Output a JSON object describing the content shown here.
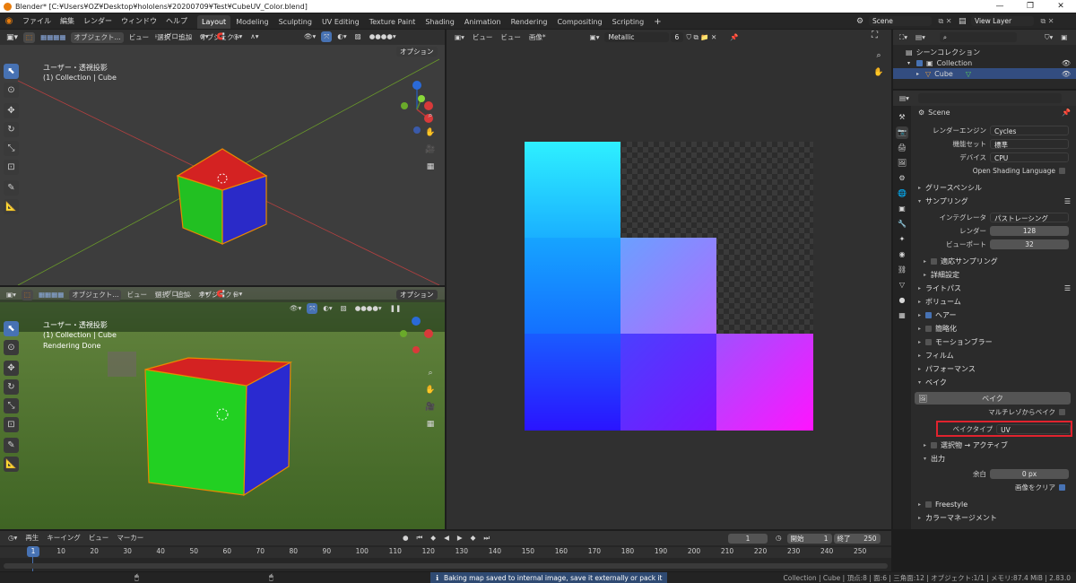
{
  "window": {
    "title": "Blender* [C:¥Users¥OZ¥Desktop¥hololens¥20200709¥Test¥CubeUV_Color.blend]"
  },
  "menu": [
    "ファイル",
    "編集",
    "レンダー",
    "ウィンドウ",
    "ヘルプ"
  ],
  "workspaces": [
    "Layout",
    "Modeling",
    "Sculpting",
    "UV Editing",
    "Texture Paint",
    "Shading",
    "Animation",
    "Rendering",
    "Compositing",
    "Scripting"
  ],
  "top_right": {
    "scene": "Scene",
    "view_layer": "View Layer"
  },
  "viewport_top": {
    "mode": "オブジェクト...",
    "menus": [
      "ビュー",
      "選択",
      "追加",
      "オブジェクト"
    ],
    "transform": "グロー...",
    "options": "オプション",
    "overlay_title": "ユーザー・透視投影",
    "overlay_sub": "(1) Collection | Cube"
  },
  "viewport_bottom": {
    "mode": "オブジェクト...",
    "menus": [
      "ビュー",
      "選択",
      "追加",
      "オブジェクト"
    ],
    "transform": "グロー...",
    "options": "オプション",
    "overlay_title": "ユーザー・透視投影",
    "overlay_sub": "(1) Collection | Cube",
    "overlay_status": "Rendering Done"
  },
  "image_editor": {
    "menus": [
      "ビュー",
      "ビュー",
      "画像*"
    ],
    "image_name": "Metallic",
    "users": "6"
  },
  "outliner": {
    "root": "シーンコレクション",
    "collection": "Collection",
    "object": "Cube"
  },
  "properties": {
    "scene": "Scene",
    "render_engine_label": "レンダーエンジン",
    "render_engine": "Cycles",
    "feature_set_label": "機能セット",
    "feature_set": "標準",
    "device_label": "デバイス",
    "device": "CPU",
    "osl_label": "Open Shading Language",
    "grease_pencil": "グリースペンシル",
    "sampling": "サンプリング",
    "integrator_label": "インテグレータ",
    "integrator": "パストレーシング",
    "render_label": "レンダー",
    "render_samples": "128",
    "viewport_label": "ビューポート",
    "viewport_samples": "32",
    "adaptive": "適応サンプリング",
    "advanced": "詳細設定",
    "light_paths": "ライトパス",
    "volumes": "ボリューム",
    "hair": "ヘアー",
    "simplify": "簡略化",
    "motion_blur": "モーションブラー",
    "film": "フィルム",
    "performance": "パフォーマンス",
    "bake": "ベイク",
    "bake_button": "ベイク",
    "multires": "マルチレゾからベイク",
    "bake_type_label": "ベイクタイプ",
    "bake_type": "UV",
    "selected_active": "選択物 → アクティブ",
    "output": "出力",
    "margin_label": "余白",
    "margin": "0 px",
    "clear_image": "画像をクリア",
    "freestyle": "Freestyle",
    "color_management": "カラーマネージメント"
  },
  "timeline": {
    "menus": [
      "再生",
      "キーイング",
      "ビュー",
      "マーカー"
    ],
    "current_frame": "1",
    "start_label": "開始",
    "start": "1",
    "end_label": "終了",
    "end": "250",
    "ticks": [
      "1",
      "10",
      "20",
      "30",
      "40",
      "50",
      "60",
      "70",
      "80",
      "90",
      "100",
      "110",
      "120",
      "130",
      "140",
      "150",
      "160",
      "170",
      "180",
      "190",
      "200",
      "210",
      "220",
      "230",
      "240",
      "250"
    ]
  },
  "status": {
    "message": "Baking map saved to internal image, save it externally or pack it",
    "stats": "Collection | Cube | 頂点:8 | 面:6 | 三角面:12 | オブジェクト:1/1 | メモリ:87.4 MiB | 2.83.0"
  },
  "colors": {
    "accent": "#4772b3",
    "highlight_box": "#e0232e",
    "active_object": "#334d80"
  }
}
